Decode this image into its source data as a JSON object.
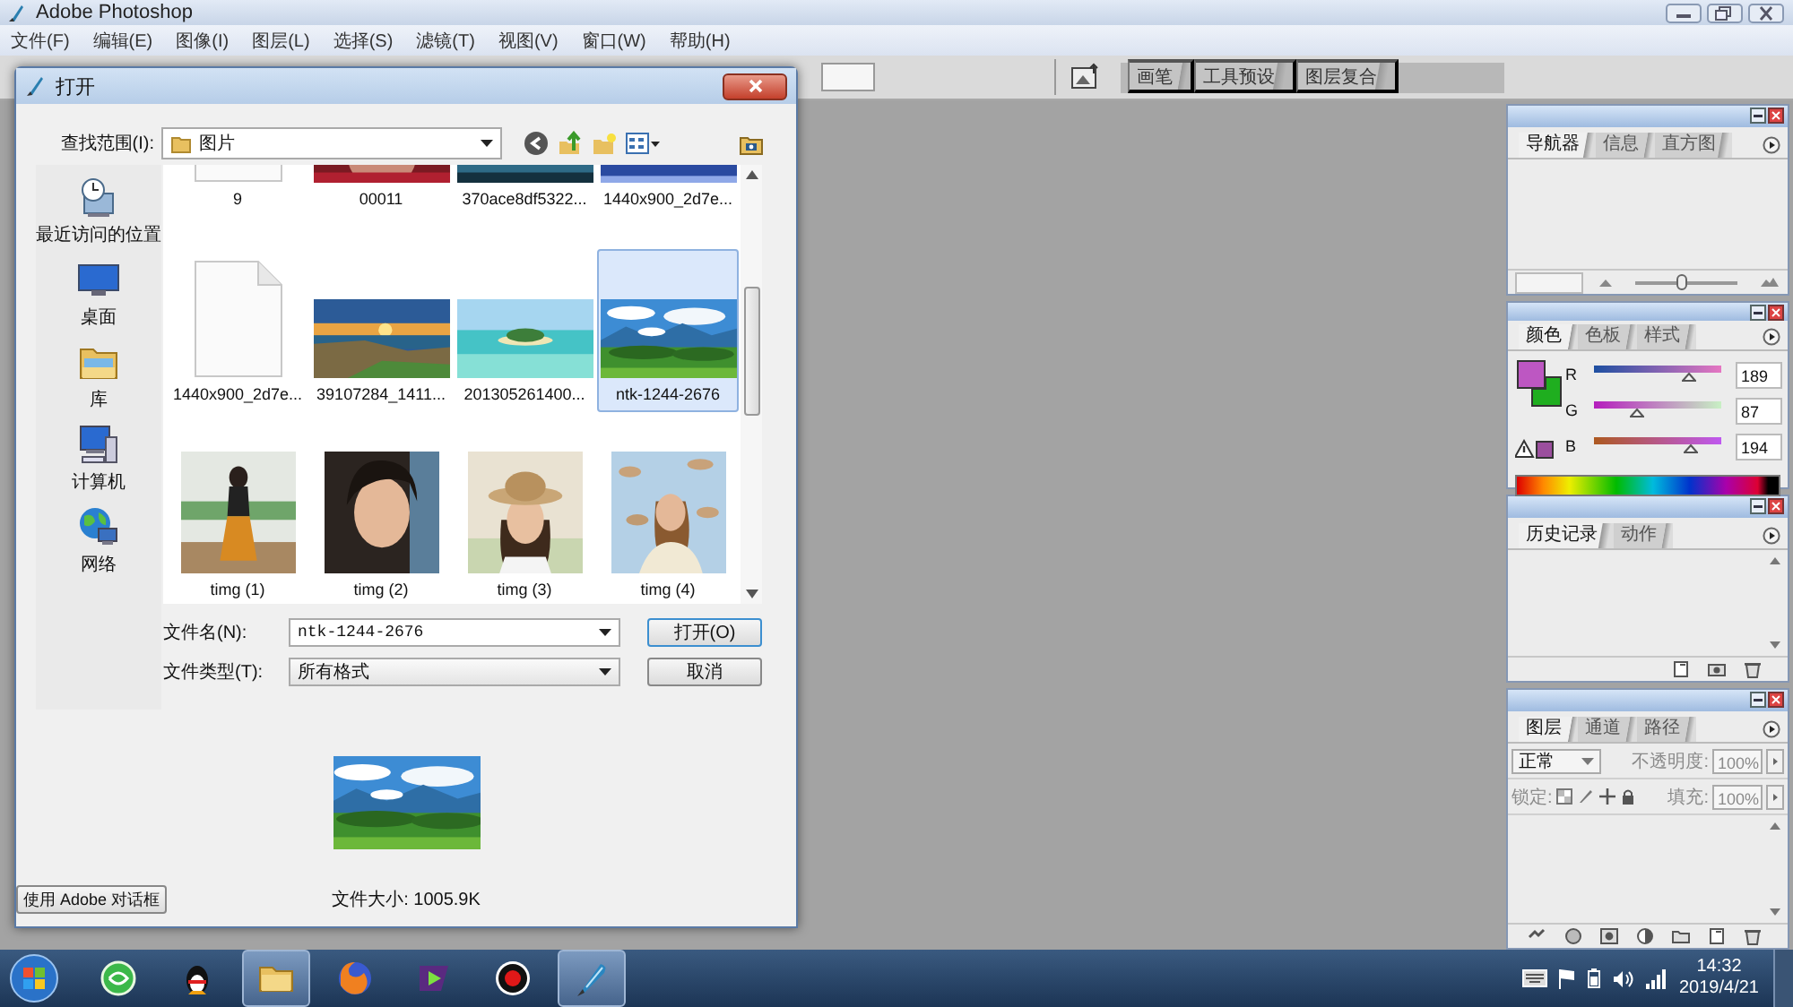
{
  "window": {
    "title": "Adobe Photoshop"
  },
  "menu": [
    "文件(F)",
    "编辑(E)",
    "图像(I)",
    "图层(L)",
    "选择(S)",
    "滤镜(T)",
    "视图(V)",
    "窗口(W)",
    "帮助(H)"
  ],
  "palette_well": [
    {
      "label": "画笔"
    },
    {
      "label": "工具预设"
    },
    {
      "label": "图层复合"
    }
  ],
  "dialog": {
    "title": "打开",
    "look_in_label": "查找范围(I):",
    "look_in": "图片",
    "places": [
      {
        "label": "最近访问的位置",
        "kind": "recent"
      },
      {
        "label": "桌面",
        "kind": "desktop"
      },
      {
        "label": "库",
        "kind": "library"
      },
      {
        "label": "计算机",
        "kind": "computer"
      },
      {
        "label": "网络",
        "kind": "network"
      }
    ],
    "files": [
      {
        "name": "9",
        "kind": "document",
        "selected": false
      },
      {
        "name": "00011",
        "kind": "picture",
        "selected": false
      },
      {
        "name": "370ace8df5322...",
        "kind": "picture",
        "selected": false
      },
      {
        "name": "1440x900_2d7e...",
        "kind": "picture",
        "selected": false
      },
      {
        "name": "1440x900_2d7e...",
        "kind": "document",
        "selected": false
      },
      {
        "name": "39107284_1411...",
        "kind": "picture",
        "selected": false
      },
      {
        "name": "201305261400...",
        "kind": "picture",
        "selected": false
      },
      {
        "name": "ntk-1244-2676",
        "kind": "picture",
        "selected": true
      },
      {
        "name": "timg (1)",
        "kind": "picture",
        "selected": false
      },
      {
        "name": "timg (2)",
        "kind": "picture",
        "selected": false
      },
      {
        "name": "timg (3)",
        "kind": "picture",
        "selected": false
      },
      {
        "name": "timg (4)",
        "kind": "picture",
        "selected": false
      }
    ],
    "file_name_label": "文件名(N):",
    "file_name": "ntk-1244-2676",
    "file_type_label": "文件类型(T):",
    "file_type": "所有格式",
    "open_button": "打开(O)",
    "cancel_button": "取消",
    "file_size": "文件大小: 1005.9K",
    "adobe_button": "使用 Adobe 对话框"
  },
  "panels": [
    {
      "kind": "navigator",
      "tabs": [
        {
          "label": "导航器",
          "selected": true
        },
        {
          "label": "信息",
          "selected": false
        },
        {
          "label": "直方图",
          "selected": false
        }
      ],
      "zoom_slider": {
        "level": 0.45
      }
    },
    {
      "kind": "color",
      "tabs": [
        {
          "label": "颜色",
          "selected": true
        },
        {
          "label": "色板",
          "selected": false
        },
        {
          "label": "样式",
          "selected": false
        }
      ],
      "swatches": [
        {
          "color": "#bd57c2"
        },
        {
          "color": "#1fae1f"
        }
      ],
      "channels": [
        {
          "name": "R",
          "value": "189",
          "level": 0.74
        },
        {
          "name": "G",
          "value": "87",
          "level": 0.34
        },
        {
          "name": "B",
          "value": "194",
          "level": 0.76
        }
      ]
    },
    {
      "kind": "history",
      "tabs": [
        {
          "label": "历史记录",
          "selected": true
        },
        {
          "label": "动作",
          "selected": false
        }
      ]
    },
    {
      "kind": "layers",
      "tabs": [
        {
          "label": "图层",
          "selected": true
        },
        {
          "label": "通道",
          "selected": false
        },
        {
          "label": "路径",
          "selected": false
        }
      ],
      "blend_mode": "正常",
      "opacity_label": "不透明度:",
      "opacity": "100%",
      "lock_label": "锁定:",
      "fill_label": "填充:",
      "fill": "100%",
      "disabled": true
    }
  ],
  "taskbar": {
    "apps": [
      {
        "kind": "swirl",
        "active": false
      },
      {
        "kind": "penguin",
        "active": false
      },
      {
        "kind": "folder",
        "active": true
      },
      {
        "kind": "fox",
        "active": false
      },
      {
        "kind": "player",
        "active": false
      },
      {
        "kind": "record",
        "active": false
      },
      {
        "kind": "feather",
        "active": true
      }
    ],
    "time": "14:32",
    "date": "2019/4/21"
  }
}
